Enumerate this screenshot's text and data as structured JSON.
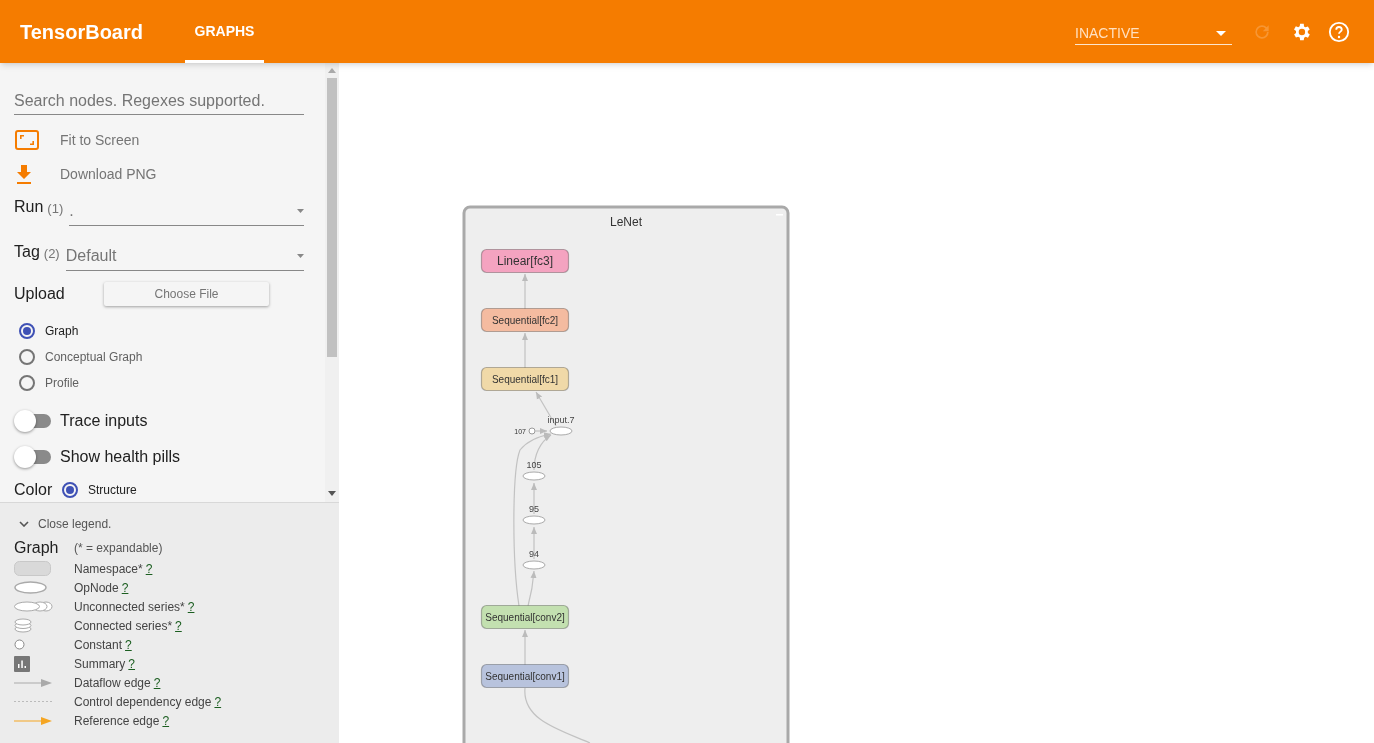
{
  "header": {
    "title": "TensorBoard",
    "tabs": [
      {
        "label": "GRAPHS",
        "selected": true
      }
    ],
    "run_selector": {
      "value": "INACTIVE"
    },
    "reload_disabled": true
  },
  "sidebar": {
    "search": {
      "placeholder": "Search nodes. Regexes supported."
    },
    "actions": [
      {
        "kind": "fit",
        "label": "Fit to Screen"
      },
      {
        "kind": "download",
        "label": "Download PNG"
      }
    ],
    "run": {
      "label": "Run",
      "count": "(1)",
      "value": "."
    },
    "tag": {
      "label": "Tag",
      "count": "(2)",
      "value": "Default"
    },
    "upload": {
      "label": "Upload",
      "button": "Choose File"
    },
    "graph_types": [
      {
        "label": "Graph",
        "selected": true
      },
      {
        "label": "Conceptual Graph",
        "selected": false
      },
      {
        "label": "Profile",
        "selected": false
      }
    ],
    "toggles": [
      {
        "label": "Trace inputs",
        "on": false
      },
      {
        "label": "Show health pills",
        "on": false
      }
    ],
    "color": {
      "label": "Color",
      "options": [
        {
          "label": "Structure",
          "selected": true
        }
      ]
    }
  },
  "legend": {
    "toggle": "Close legend.",
    "title": "Graph",
    "note": "(* = expandable)",
    "items": [
      {
        "kind": "namespace",
        "label": "Namespace*",
        "link": "?"
      },
      {
        "kind": "opnode",
        "label": "OpNode",
        "link": "?"
      },
      {
        "kind": "unconnected",
        "label": "Unconnected series*",
        "link": "?"
      },
      {
        "kind": "connected",
        "label": "Connected series*",
        "link": "?"
      },
      {
        "kind": "constant",
        "label": "Constant",
        "link": "?"
      },
      {
        "kind": "summary",
        "label": "Summary",
        "link": "?"
      },
      {
        "kind": "dataflow",
        "label": "Dataflow edge",
        "link": "?"
      },
      {
        "kind": "control",
        "label": "Control dependency edge",
        "link": "?"
      },
      {
        "kind": "reference",
        "label": "Reference edge",
        "link": "?"
      }
    ]
  },
  "graph": {
    "title": "LeNet",
    "nodes": [
      {
        "kind": "namespace",
        "label": "Linear[fc3]",
        "color": "#f4a3c0"
      },
      {
        "kind": "namespace",
        "label": "Sequential[fc2]",
        "color": "#f4bba0"
      },
      {
        "kind": "namespace",
        "label": "Sequential[fc1]",
        "color": "#f0d9a8"
      },
      {
        "kind": "op",
        "label": "input.7"
      },
      {
        "kind": "constant",
        "label": "107"
      },
      {
        "kind": "op",
        "label": "105"
      },
      {
        "kind": "op",
        "label": "95"
      },
      {
        "kind": "op",
        "label": "94"
      },
      {
        "kind": "namespace",
        "label": "Sequential[conv2]",
        "color": "#c3e0b0"
      },
      {
        "kind": "namespace",
        "label": "Sequential[conv1]",
        "color": "#b8c3dd"
      }
    ]
  }
}
